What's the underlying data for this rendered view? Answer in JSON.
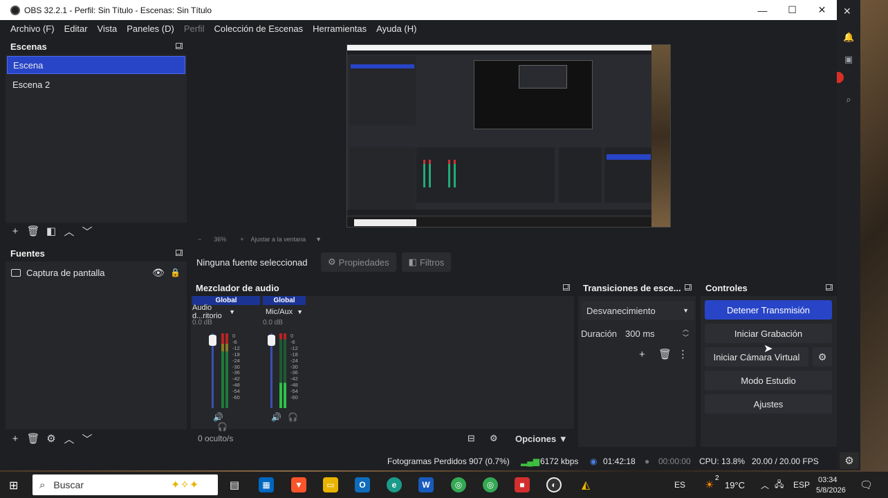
{
  "window": {
    "title": "OBS 32.2.1 - Perfil: Sin Título - Escenas: Sin Título",
    "minimize": "—",
    "maximize": "☐",
    "close": "✕"
  },
  "menu": {
    "items": [
      "Archivo (F)",
      "Editar",
      "Vista",
      "Paneles (D)",
      "Perfil",
      "Colección de Escenas",
      "Herramientas",
      "Ayuda (H)"
    ]
  },
  "scenes": {
    "title": "Escenas",
    "items": [
      "Escena",
      "Escena 2"
    ],
    "selected": 0
  },
  "preview": {
    "zoom": "36%",
    "fit_label": "Ajustar a la ventana"
  },
  "sources": {
    "title": "Fuentes",
    "items": [
      "Captura de pantalla"
    ]
  },
  "source_bar": {
    "none_selected": "Ninguna fuente seleccionada",
    "properties": "Propiedades",
    "filters": "Filtros"
  },
  "mixer": {
    "title": "Mezclador de audio",
    "channels": [
      {
        "badge": "Global",
        "name": "Audio d...ritorio",
        "db": "0.0 dB"
      },
      {
        "badge": "Global",
        "name": "Mic/Aux",
        "db": "0.0 dB"
      }
    ],
    "scale": [
      "0",
      "-6",
      "-12",
      "-18",
      "-24",
      "-30",
      "-36",
      "-42",
      "-48",
      "-54",
      "-60"
    ],
    "hidden": "0 oculto/s",
    "options": "Opciones"
  },
  "transitions": {
    "title": "Transiciones de esce...",
    "selected": "Desvanecimiento",
    "duration_label": "Duración",
    "duration_value": "300 ms"
  },
  "controls": {
    "title": "Controles",
    "stop_stream": "Detener Transmisión",
    "start_record": "Iniciar Grabación",
    "start_vcam": "Iniciar Cámara Virtual",
    "studio_mode": "Modo Estudio",
    "settings": "Ajustes"
  },
  "status": {
    "dropped": "Fotogramas Perdidos 907 (0.7%)",
    "bitrate": "6172 kbps",
    "stream_time": "01:42:18",
    "record_time": "00:00:00",
    "cpu": "CPU: 13.8%",
    "fps": "20.00 / 20.00 FPS"
  },
  "taskbar": {
    "search_placeholder": "Buscar",
    "lang": "ES",
    "temp": "19°C",
    "weather_badge": "2",
    "kbd": "ESP",
    "time": "03:34",
    "date": "5/8/2026"
  },
  "colors": {
    "accent": "#2845c8",
    "bg": "#1e1f22",
    "panel": "#26272b"
  }
}
